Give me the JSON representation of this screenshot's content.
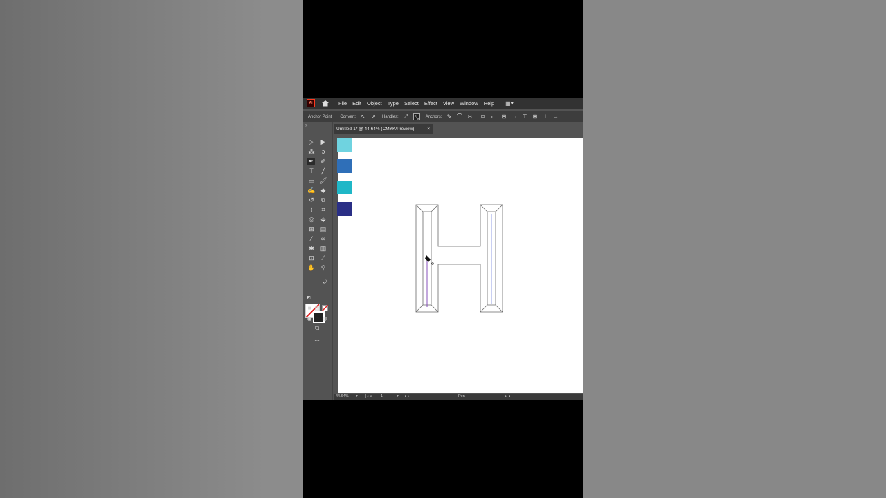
{
  "app": {
    "logo_text": "Ai",
    "menus": [
      "File",
      "Edit",
      "Object",
      "Type",
      "Select",
      "Effect",
      "View",
      "Window",
      "Help"
    ],
    "workspace_icon": "workspace-switcher-icon"
  },
  "control_bar": {
    "anchor_point_label": "Anchor Point",
    "convert_label": "Convert:",
    "handles_label": "Handles:",
    "anchors_label": "Anchors:"
  },
  "document_tab": {
    "title": "Untitled-1* @ 44.64% (CMYK/Preview)",
    "close": "×"
  },
  "swatches": [
    "#6fd3e0",
    "#2f6fb8",
    "#1fb7c7",
    "#2a2f86"
  ],
  "status_bar": {
    "zoom": "44.64%",
    "artboard": "1",
    "mode": "Pen"
  },
  "colors": {
    "fill": "#ffffff",
    "stroke": "#222222",
    "path_guide_purple": "#7a3fb4",
    "path_guide_blue": "#4b5fd6"
  }
}
